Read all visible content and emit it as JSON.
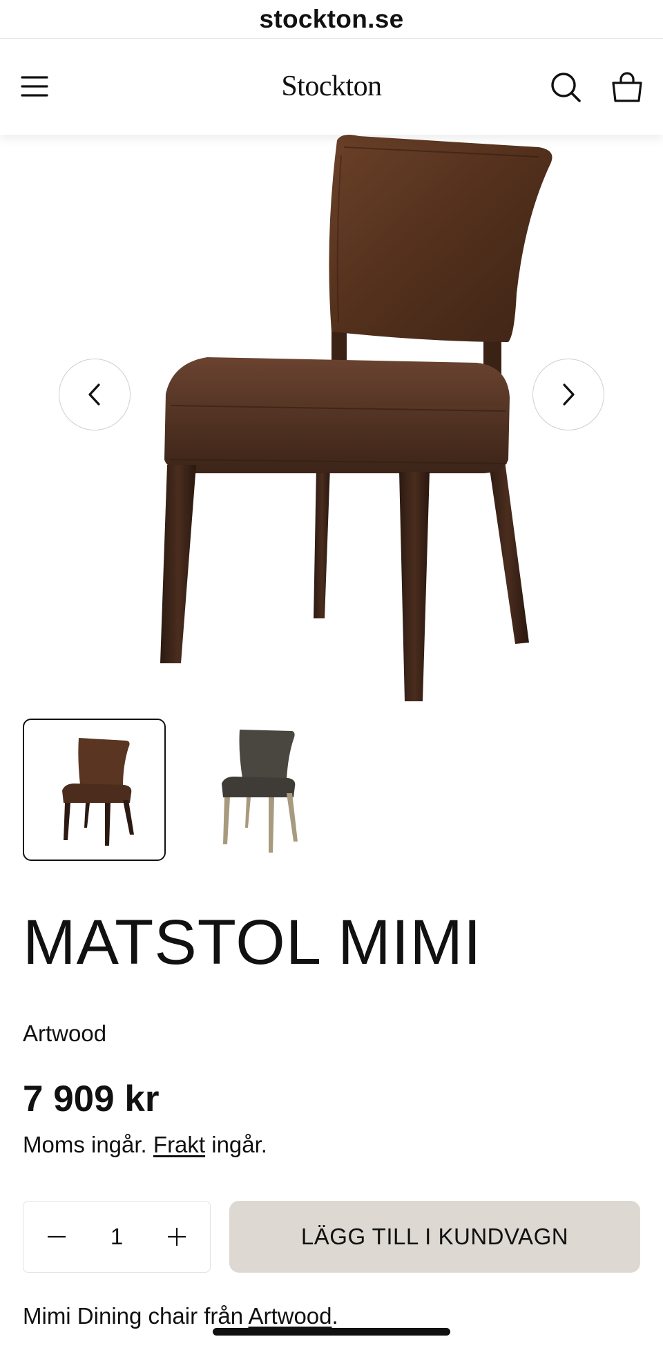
{
  "browser": {
    "url": "stockton.se"
  },
  "header": {
    "logo": "Stockton",
    "menu_icon": "hamburger-menu-icon",
    "search_icon": "search-icon",
    "cart_icon": "shopping-bag-icon"
  },
  "gallery": {
    "prev_icon": "chevron-left-icon",
    "next_icon": "chevron-right-icon",
    "thumbnails": [
      {
        "variant": "brown-leather-dark-legs",
        "active": true
      },
      {
        "variant": "grey-leather-light-legs",
        "active": false
      }
    ]
  },
  "product": {
    "title": "MATSTOL MIMI",
    "brand": "Artwood",
    "price": "7 909 kr",
    "tax_prefix": "Moms ingår.",
    "shipping_link": "Frakt",
    "tax_suffix": "ingår."
  },
  "cart": {
    "quantity": "1",
    "minus_icon": "minus-icon",
    "plus_icon": "plus-icon",
    "add_label": "LÄGG TILL I KUNDVAGN"
  },
  "description": {
    "prefix": "Mimi Dining chair från",
    "brand_link": "Artwood",
    "suffix": "."
  },
  "colors": {
    "accent_button": "#ddd8d2",
    "text": "#111111",
    "leather_brown": "#5a3522",
    "leather_grey": "#4a4640"
  }
}
